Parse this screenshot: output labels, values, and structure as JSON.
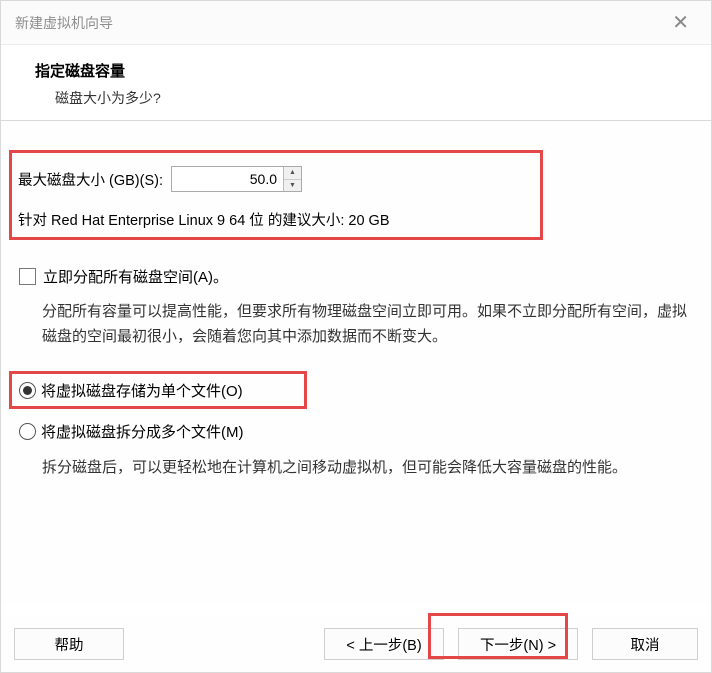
{
  "window": {
    "title": "新建虚拟机向导"
  },
  "header": {
    "title": "指定磁盘容量",
    "subtitle": "磁盘大小为多少?"
  },
  "diskSize": {
    "label": "最大磁盘大小 (GB)(S):",
    "value": "50.0",
    "recommendation": "针对 Red Hat Enterprise Linux 9 64 位 的建议大小: 20 GB"
  },
  "allocateNow": {
    "label": "立即分配所有磁盘空间(A)。",
    "description": "分配所有容量可以提高性能，但要求所有物理磁盘空间立即可用。如果不立即分配所有空间，虚拟磁盘的空间最初很小，会随着您向其中添加数据而不断变大。"
  },
  "storage": {
    "singleFile": "将虚拟磁盘存储为单个文件(O)",
    "splitFiles": "将虚拟磁盘拆分成多个文件(M)",
    "splitDescription": "拆分磁盘后，可以更轻松地在计算机之间移动虚拟机，但可能会降低大容量磁盘的性能。"
  },
  "buttons": {
    "help": "帮助",
    "back": "< 上一步(B)",
    "next": "下一步(N) >",
    "cancel": "取消"
  }
}
